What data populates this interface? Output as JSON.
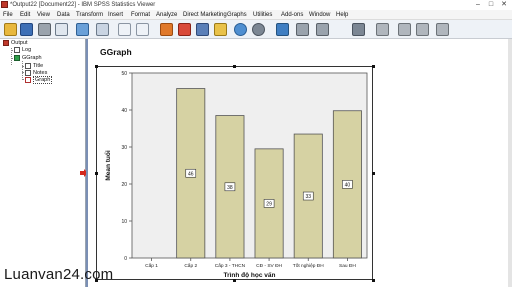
{
  "window": {
    "title": "*Output22 [Document22] - IBM SPSS Statistics Viewer",
    "minimize": "–",
    "maximize": "□",
    "close": "✕"
  },
  "menu": [
    "File",
    "Edit",
    "View",
    "Data",
    "Transform",
    "Insert",
    "Format",
    "Analyze",
    "Direct Marketing",
    "Graphs",
    "Utilities",
    "Add-ons",
    "Window",
    "Help"
  ],
  "toolbar": {
    "icons": [
      "open-icon",
      "save-icon",
      "print-icon",
      "print-preview-icon",
      "export-icon",
      "recall-dialog-icon",
      "undo-icon",
      "redo-icon",
      "goto-data-icon",
      "goto-case-icon",
      "goto-variable-icon",
      "variables-icon",
      "select-last-output-icon",
      "designate-window-icon",
      "promote-icon",
      "demote-icon",
      "expand-icon",
      "collapse-icon",
      "show-icon",
      "hide-icon",
      "insert-heading-icon",
      "insert-title-icon"
    ]
  },
  "nav_tree": {
    "items": [
      {
        "label": "Output",
        "level": 0,
        "icon": "output-book-icon"
      },
      {
        "label": "Log",
        "level": 1,
        "icon": "log-icon"
      },
      {
        "label": "GGraph",
        "level": 1,
        "icon": "book-icon"
      },
      {
        "label": "Title",
        "level": 2,
        "icon": "title-icon"
      },
      {
        "label": "Notes",
        "level": 2,
        "icon": "notes-icon"
      },
      {
        "label": "Graph",
        "level": 2,
        "icon": "graph-icon",
        "selected": true
      }
    ]
  },
  "content": {
    "heading": "GGraph"
  },
  "chart_data": {
    "type": "bar",
    "categories": [
      "Cấp 1",
      "Cấp 2",
      "Cấp 3 - THCN",
      "CĐ - SV ĐH",
      "Tốt nghiệp ĐH",
      "Sau ĐH"
    ],
    "values": [
      null,
      45.8,
      38.5,
      29.5,
      33.5,
      39.8
    ],
    "data_labels": [
      "",
      "46",
      "38",
      "29",
      "33",
      "40"
    ],
    "ylabel": "Mean tuổi",
    "xlabel": "Trình độ học vấn",
    "ylim": [
      0,
      50
    ],
    "yticks": [
      0,
      10,
      20,
      30,
      40,
      50
    ],
    "bar_color": "#d6d2a3",
    "bar_stroke": "#555555",
    "plot_bg": "#efefef"
  },
  "watermark": "Luanvan24.com"
}
